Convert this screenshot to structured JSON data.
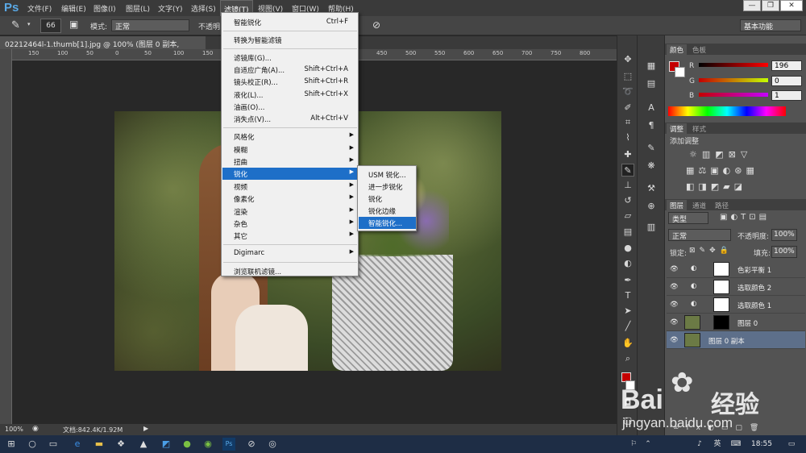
{
  "app": {
    "logo": "Ps"
  },
  "menubar": {
    "items": [
      "文件(F)",
      "编辑(E)",
      "图像(I)",
      "图层(L)",
      "文字(Y)",
      "选择(S)",
      "滤镜(T)",
      "视图(V)",
      "窗口(W)",
      "帮助(H)"
    ],
    "active": "滤镜(T)"
  },
  "options_bar": {
    "brush_size": "66",
    "mode_label": "模式:",
    "mode_value": "正常",
    "opacity_label": "不透明",
    "workspace": "基本功能"
  },
  "document_tab": {
    "title": "02212464l-1.thumb[1].jpg @ 100% (图层 0 副本, RGB/8#) *",
    "close": "×"
  },
  "ruler_h": [
    "150",
    "100",
    "50",
    "0",
    "50",
    "100",
    "150",
    "200",
    "250",
    "300",
    "350",
    "400",
    "450",
    "500",
    "550",
    "600",
    "650",
    "700",
    "750",
    "800"
  ],
  "status": {
    "zoom": "100%",
    "doc": "文档:842.4K/1.92M"
  },
  "filter_menu": {
    "items": [
      {
        "label": "智能锐化",
        "shortcut": "Ctrl+F"
      },
      {
        "label": "转换为智能滤镜",
        "shortcut": ""
      },
      {
        "label": "滤镜库(G)...",
        "shortcut": ""
      },
      {
        "label": "自适应广角(A)...",
        "shortcut": "Shift+Ctrl+A"
      },
      {
        "label": "镜头校正(R)...",
        "shortcut": "Shift+Ctrl+R"
      },
      {
        "label": "液化(L)...",
        "shortcut": "Shift+Ctrl+X"
      },
      {
        "label": "油画(O)...",
        "shortcut": ""
      },
      {
        "label": "消失点(V)...",
        "shortcut": "Alt+Ctrl+V"
      },
      {
        "label": "风格化",
        "shortcut": ""
      },
      {
        "label": "模糊",
        "shortcut": ""
      },
      {
        "label": "扭曲",
        "shortcut": ""
      },
      {
        "label": "锐化",
        "shortcut": ""
      },
      {
        "label": "视频",
        "shortcut": ""
      },
      {
        "label": "像素化",
        "shortcut": ""
      },
      {
        "label": "渲染",
        "shortcut": ""
      },
      {
        "label": "杂色",
        "shortcut": ""
      },
      {
        "label": "其它",
        "shortcut": ""
      },
      {
        "label": "Digimarc",
        "shortcut": ""
      },
      {
        "label": "浏览联机滤镜...",
        "shortcut": ""
      }
    ]
  },
  "sharpen_submenu": {
    "items": [
      "USM 锐化...",
      "进一步锐化",
      "锐化",
      "锐化边缘",
      "智能锐化..."
    ]
  },
  "color_panel": {
    "tabs": [
      "颜色",
      "色板"
    ],
    "r_label": "R",
    "g_label": "G",
    "b_label": "B",
    "r": "196",
    "g": "0",
    "b": "1",
    "fg_color": "#c40001"
  },
  "adjust_panel": {
    "tabs": [
      "调整",
      "样式"
    ],
    "title": "添加调整"
  },
  "layers_panel": {
    "tabs": [
      "图层",
      "通道",
      "路径"
    ],
    "kind_label": "类型",
    "blend": "正常",
    "opacity_label": "不透明度:",
    "opacity": "100%",
    "lock_label": "锁定:",
    "fill_label": "填充:",
    "fill": "100%",
    "layers": [
      {
        "name": "色彩平衡 1",
        "selected": false
      },
      {
        "name": "选取颜色 2",
        "selected": false
      },
      {
        "name": "选取颜色 1",
        "selected": false
      },
      {
        "name": "图层 0",
        "selected": false
      },
      {
        "name": "图层 0 副本",
        "selected": true
      }
    ]
  },
  "taskbar": {
    "ime": "英",
    "time": "18:55"
  },
  "watermark": {
    "brand": "Bai",
    "brand2": "经验",
    "url": "jingyan.baidu.com"
  }
}
